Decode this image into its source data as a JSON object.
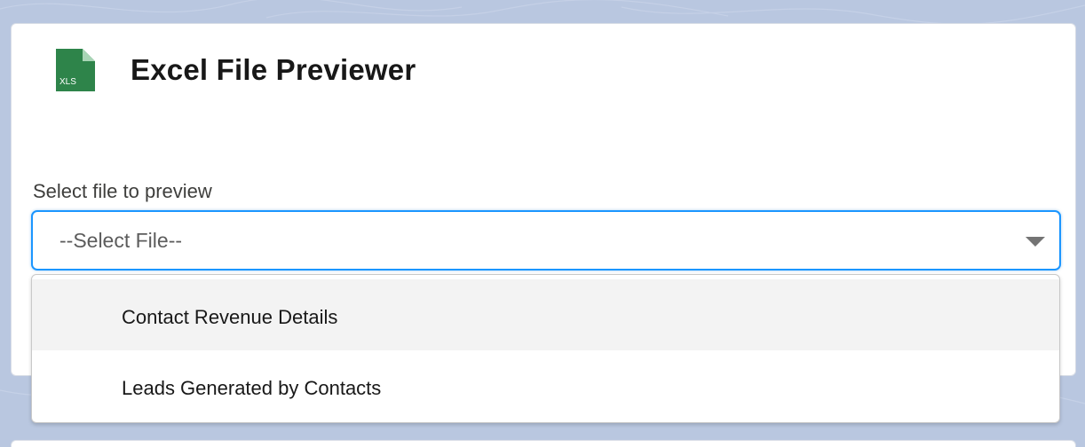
{
  "card": {
    "title": "Excel File Previewer",
    "icon": "xls-file-icon",
    "icon_text": "XLS",
    "accent_color": "#2e844a"
  },
  "file_select": {
    "label": "Select file to preview",
    "value": "--Select File--",
    "focus_color": "#1b96ff",
    "options": [
      {
        "label": "Contact Revenue Details"
      },
      {
        "label": "Leads Generated by Contacts"
      }
    ]
  }
}
